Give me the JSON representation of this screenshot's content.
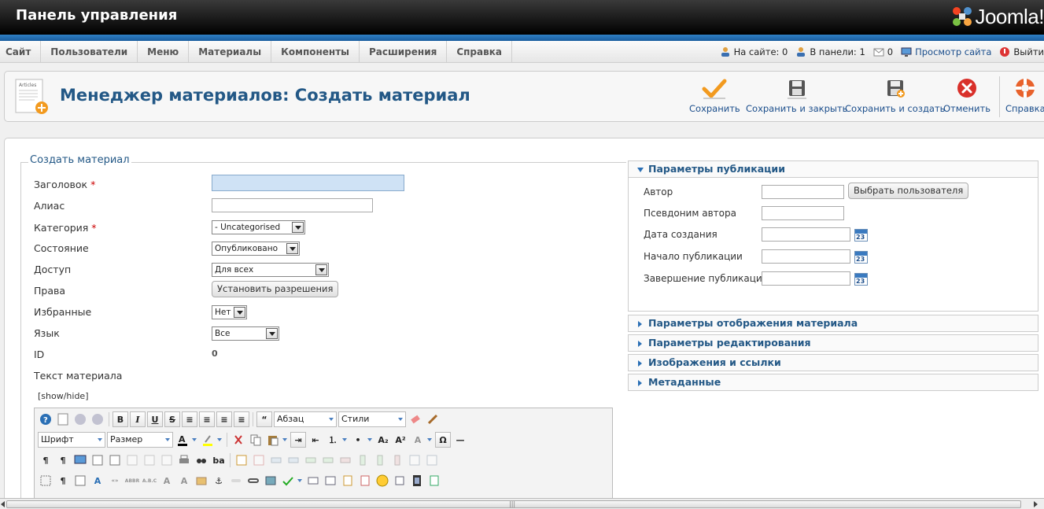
{
  "header": {
    "title": "Панель управления",
    "logo_text": "Joomla!"
  },
  "menu": {
    "items": [
      "Сайт",
      "Пользователи",
      "Меню",
      "Материалы",
      "Компоненты",
      "Расширения",
      "Справка"
    ]
  },
  "status": {
    "on_site": "На сайте: 0",
    "in_panel": "В панели: 1",
    "messages": "0",
    "view_site": "Просмотр сайта",
    "logout": "Выйти"
  },
  "toolbar": {
    "page_title": "Менеджер материалов: Создать материал",
    "doc_icon_text": "Articles",
    "buttons": {
      "save": "Сохранить",
      "save_close": "Сохранить и закрыть",
      "save_new": "Сохранить и создать",
      "cancel": "Отменить",
      "help": "Справка"
    }
  },
  "form": {
    "legend": "Создать материал",
    "title_label": "Заголовок",
    "title_value": "",
    "required_mark": "*",
    "alias_label": "Алиас",
    "alias_value": "",
    "category_label": "Категория",
    "category_value": "- Uncategorised",
    "state_label": "Состояние",
    "state_value": "Опубликовано",
    "access_label": "Доступ",
    "access_value": "Для всех",
    "rights_label": "Права",
    "rights_button": "Установить разрешения",
    "featured_label": "Избранные",
    "featured_value": "Нет",
    "language_label": "Язык",
    "language_value": "Все",
    "id_label": "ID",
    "id_value": "0",
    "text_label": "Текст материала",
    "show_hide": "[show/hide]"
  },
  "editor": {
    "format_select": "Абзац",
    "styles_select": "Стили",
    "font_select": "Шрифт",
    "size_select": "Размер шрифта"
  },
  "publishing": {
    "header": "Параметры публикации",
    "author_label": "Автор",
    "author_value": "",
    "select_user_button": "Выбрать пользователя",
    "alias_label": "Псевдоним автора",
    "created_label": "Дата создания",
    "publish_up_label": "Начало публикации",
    "publish_down_label": "Завершение публикации",
    "calendar_day": "23"
  },
  "panels": {
    "display": "Параметры отображения материала",
    "editing": "Параметры редактирования",
    "images": "Изображения и ссылки",
    "metadata": "Метаданные"
  },
  "colors": {
    "accent": "#235886",
    "brand_blue": "#1a5e9f",
    "required": "#cc0000",
    "save_orange": "#f29a1f",
    "cancel_red": "#d9302a"
  }
}
